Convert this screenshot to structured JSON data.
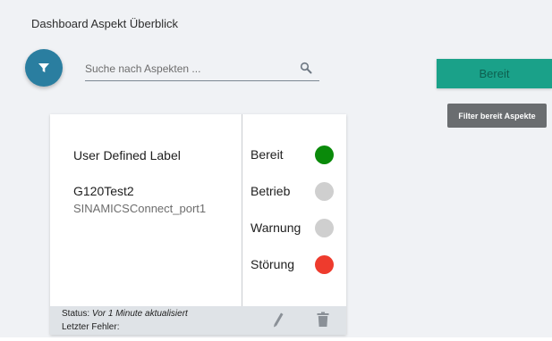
{
  "header": {
    "title": "Dashboard Aspekt Überblick"
  },
  "filter": {
    "icon": "filter-icon"
  },
  "search": {
    "placeholder": "Suche nach Aspekten ...",
    "value": "",
    "icon": "search-icon"
  },
  "status_button": {
    "label": "Bereit",
    "color": "#1aa189"
  },
  "tooltip": {
    "text": "Filter bereit Aspekte"
  },
  "card": {
    "label": "User Defined Label",
    "device_name": "G120Test2",
    "device_port": "SINAMICSConnect_port1",
    "states": [
      {
        "label": "Bereit",
        "color": "#0a8a0a",
        "active": true
      },
      {
        "label": "Betrieb",
        "color": "#cfcfcf",
        "active": false
      },
      {
        "label": "Warnung",
        "color": "#cfcfcf",
        "active": false
      },
      {
        "label": "Störung",
        "color": "#ee3b2d",
        "active": true
      }
    ],
    "footer": {
      "status_label": "Status:",
      "status_value": "Vor 1 Minute aktualisiert",
      "error_label": "Letzter Fehler:",
      "edit_icon": "edit-icon",
      "delete_icon": "trash-icon"
    }
  },
  "colors": {
    "accent": "#2a7ea0",
    "background": "#f0f2f5"
  }
}
